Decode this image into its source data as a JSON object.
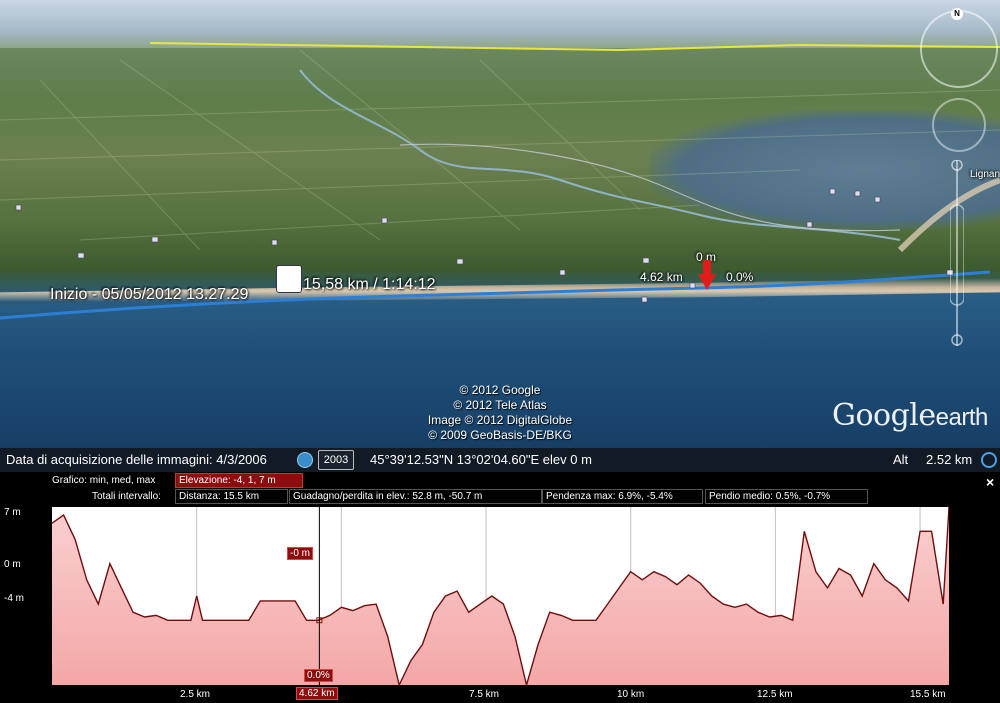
{
  "viewer": {
    "start_label": "Inizio - 05/05/2012 13.27.29",
    "track_label": "15,58 km / 1:14:12",
    "marker_distance": "4.62 km",
    "marker_elevation": "0 m",
    "marker_slope": "0.0%",
    "place_label": "Lignan",
    "copyright": [
      "© 2012 Google",
      "© 2012 Tele Atlas",
      "Image © 2012 DigitalGlobe",
      "© 2009 GeoBasis-DE/BKG"
    ],
    "logo_google": "Google",
    "logo_earth": "earth",
    "compass_n": "N"
  },
  "status": {
    "imagery_date": "Data di acquisizione delle immagini: 4/3/2006",
    "year": "2003",
    "coords": "45°39'12.53\"N   13°02'04.60\"E  elev     0 m",
    "alt_label": "Alt",
    "alt_value": "2.52 km"
  },
  "profile": {
    "graph_label": "Grafico: min, med, max",
    "elevation": "Elevazione: -4, 1, 7 m",
    "totals_label": "Totali intervallo:",
    "distance": "Distanza: 15.5 km",
    "gain_loss": "Guadagno/perdita in elev.: 52.8 m, -50.7 m",
    "max_slope": "Pendenza max: 6.9%, -5.4%",
    "avg_slope": "Pendio medio: 0.5%, -0.7%",
    "close": "×",
    "cursor_elev": "-0 m",
    "cursor_slope": "0.0%",
    "y_ticks": [
      "7 m",
      "0 m",
      "-4 m"
    ],
    "x_ticks": [
      "2.5 km",
      "4.62 km",
      "7.5 km",
      "10 km",
      "12.5 km",
      "15.5 km"
    ]
  },
  "chart_data": {
    "type": "area",
    "xlabel": "",
    "ylabel": "",
    "xlim": [
      0,
      15.5
    ],
    "ylim": [
      -4,
      7
    ],
    "cursor_x": 4.62,
    "x": [
      0,
      0.2,
      0.4,
      0.6,
      0.8,
      1.0,
      1.2,
      1.4,
      1.6,
      1.8,
      2.0,
      2.2,
      2.4,
      2.5,
      2.6,
      2.8,
      3.0,
      3.2,
      3.4,
      3.6,
      3.8,
      4.0,
      4.2,
      4.4,
      4.6,
      4.8,
      5.0,
      5.2,
      5.4,
      5.6,
      5.8,
      6.0,
      6.2,
      6.4,
      6.6,
      6.8,
      7.0,
      7.2,
      7.4,
      7.6,
      7.8,
      8.0,
      8.2,
      8.4,
      8.6,
      8.8,
      9.0,
      9.2,
      9.4,
      9.6,
      9.8,
      10.0,
      10.2,
      10.4,
      10.6,
      10.8,
      11.0,
      11.2,
      11.4,
      11.6,
      11.8,
      12.0,
      12.2,
      12.4,
      12.6,
      12.8,
      13.0,
      13.2,
      13.4,
      13.6,
      13.8,
      14.0,
      14.2,
      14.4,
      14.6,
      14.8,
      15.0,
      15.2,
      15.4,
      15.5
    ],
    "y": [
      6.0,
      6.5,
      5.0,
      2.5,
      1.0,
      3.5,
      2.0,
      0.5,
      0.2,
      0.3,
      0.0,
      0.0,
      0.0,
      1.5,
      0.0,
      0.0,
      0.0,
      0.0,
      0.0,
      1.2,
      1.2,
      1.2,
      1.2,
      0.0,
      0.0,
      0.3,
      0.8,
      0.6,
      0.9,
      1.0,
      -1.0,
      -4.0,
      -2.5,
      -1.5,
      0.5,
      1.5,
      1.8,
      0.5,
      1.0,
      1.5,
      1.0,
      -1.0,
      -4.0,
      -1.5,
      0.5,
      0.3,
      0.0,
      0.0,
      0.0,
      1.0,
      2.0,
      3.0,
      2.5,
      3.0,
      2.7,
      2.2,
      2.8,
      2.3,
      1.5,
      1.0,
      0.8,
      1.0,
      0.5,
      0.2,
      0.3,
      0.0,
      5.5,
      3.0,
      2.0,
      3.2,
      2.8,
      1.5,
      3.5,
      2.5,
      2.0,
      1.2,
      5.5,
      5.5,
      1.0,
      7.0
    ]
  },
  "colors": {
    "profile_fill": "#f4a7a7",
    "profile_line": "#6e0e0e",
    "track": "#2d7fd6",
    "highlight": "#8b0d0d",
    "marker": "#e21b1b"
  }
}
